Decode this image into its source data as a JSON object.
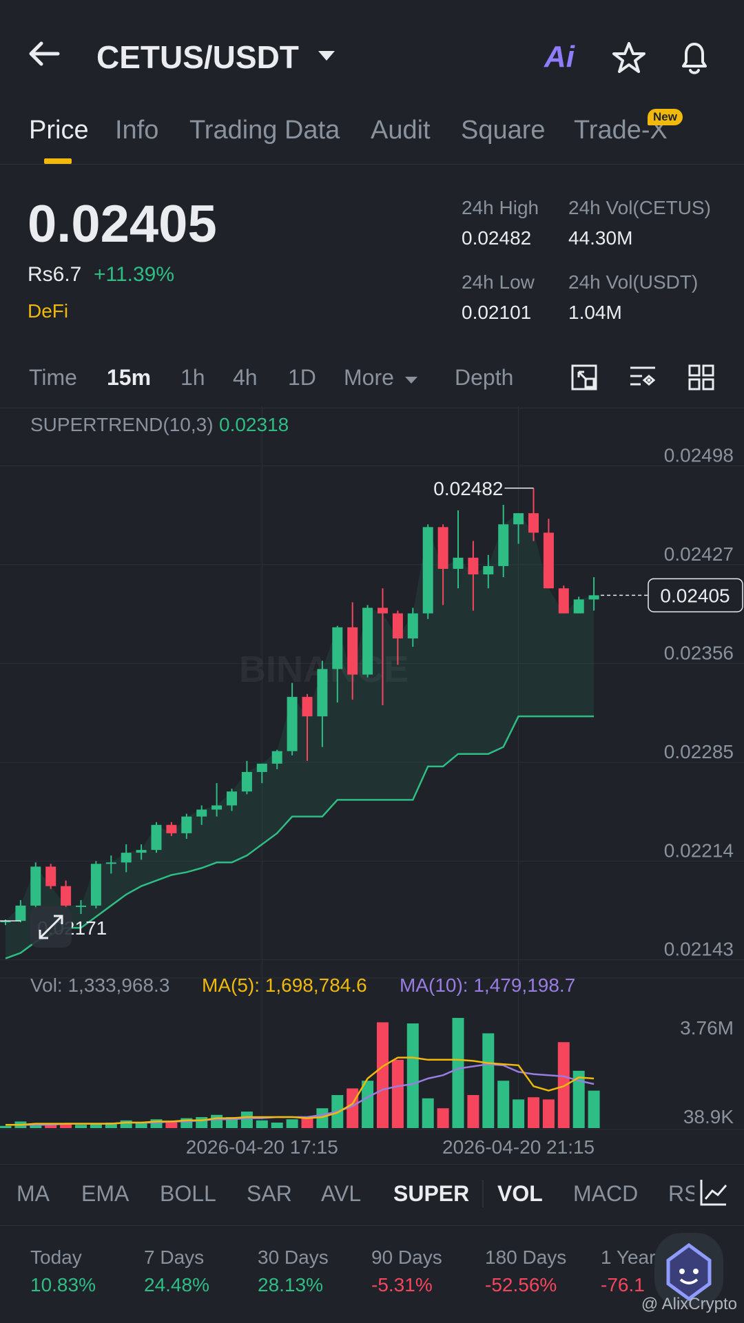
{
  "header": {
    "pair": "CETUS/USDT",
    "ai_label": "Ai"
  },
  "tabs": [
    {
      "label": "Price",
      "active": true
    },
    {
      "label": "Info"
    },
    {
      "label": "Trading Data"
    },
    {
      "label": "Audit"
    },
    {
      "label": "Square"
    },
    {
      "label": "Trade-X",
      "badge": "New"
    }
  ],
  "price": {
    "last": "0.02405",
    "fiat": "Rs6.7",
    "change": "+11.39%",
    "tag": "DeFi"
  },
  "stats": {
    "high_label": "24h High",
    "high": "0.02482",
    "vol_base_label": "24h Vol(CETUS)",
    "vol_base": "44.30M",
    "low_label": "24h Low",
    "low": "0.02101",
    "vol_quote_label": "24h Vol(USDT)",
    "vol_quote": "1.04M"
  },
  "intervals": [
    "Time",
    "15m",
    "1h",
    "4h",
    "1D",
    "More",
    "Depth"
  ],
  "active_interval": "15m",
  "chart_labels": {
    "supertrend_label": "SUPERTREND(10,3)",
    "supertrend_value": "0.02318",
    "watermark": "BINANCE",
    "current_price_tag": "0.02405",
    "high_marker": "0.02482",
    "low_marker": "0.02171",
    "vol_label": "Vol: 1,333,968.3",
    "ma5_label": "MA(5): 1,698,784.6",
    "ma10_label": "MA(10): 1,479,198.7",
    "vol_axis_top": "3.76M",
    "vol_axis_bottom": "38.9K"
  },
  "chart_data": {
    "type": "candlestick",
    "interval": "15m",
    "yticks": [
      "0.02498",
      "0.02427",
      "0.02356",
      "0.02285",
      "0.02214",
      "0.02143"
    ],
    "xticks": [
      "2026-04-20 17:15",
      "2026-04-20 21:15"
    ],
    "candles": [
      [
        0.0217,
        0.02172,
        0.02168,
        0.02171
      ],
      [
        0.02171,
        0.02186,
        0.0217,
        0.02182
      ],
      [
        0.02182,
        0.02213,
        0.0218,
        0.0221
      ],
      [
        0.0221,
        0.02212,
        0.02194,
        0.02196
      ],
      [
        0.02196,
        0.022,
        0.0218,
        0.02182
      ],
      [
        0.02182,
        0.02186,
        0.02176,
        0.02182
      ],
      [
        0.02182,
        0.02214,
        0.0218,
        0.02212
      ],
      [
        0.02212,
        0.02218,
        0.02205,
        0.02213
      ],
      [
        0.02213,
        0.02226,
        0.02206,
        0.0222
      ],
      [
        0.0222,
        0.02226,
        0.02215,
        0.02222
      ],
      [
        0.02222,
        0.02242,
        0.0222,
        0.0224
      ],
      [
        0.0224,
        0.02242,
        0.02232,
        0.02234
      ],
      [
        0.02234,
        0.02248,
        0.0223,
        0.02246
      ],
      [
        0.02246,
        0.02254,
        0.0224,
        0.02251
      ],
      [
        0.02251,
        0.0227,
        0.02246,
        0.02254
      ],
      [
        0.02254,
        0.02266,
        0.0225,
        0.02264
      ],
      [
        0.02264,
        0.02286,
        0.02262,
        0.02278
      ],
      [
        0.02278,
        0.02284,
        0.0227,
        0.02284
      ],
      [
        0.02284,
        0.02294,
        0.0228,
        0.02293
      ],
      [
        0.02293,
        0.02342,
        0.0229,
        0.02332
      ],
      [
        0.02332,
        0.02334,
        0.02286,
        0.02318
      ],
      [
        0.02318,
        0.02358,
        0.02296,
        0.02352
      ],
      [
        0.02352,
        0.02383,
        0.02328,
        0.02382
      ],
      [
        0.02382,
        0.024,
        0.0233,
        0.02348
      ],
      [
        0.02348,
        0.02398,
        0.02346,
        0.02396
      ],
      [
        0.02396,
        0.0241,
        0.02326,
        0.02392
      ],
      [
        0.02392,
        0.02394,
        0.02355,
        0.02374
      ],
      [
        0.02374,
        0.02396,
        0.02368,
        0.02392
      ],
      [
        0.02392,
        0.02456,
        0.02388,
        0.02454
      ],
      [
        0.02454,
        0.02456,
        0.02398,
        0.02424
      ],
      [
        0.02424,
        0.02466,
        0.0241,
        0.02432
      ],
      [
        0.02432,
        0.02444,
        0.02394,
        0.0242
      ],
      [
        0.0242,
        0.02434,
        0.0241,
        0.02426
      ],
      [
        0.02426,
        0.0247,
        0.02418,
        0.02456
      ],
      [
        0.02456,
        0.02464,
        0.02442,
        0.02464
      ],
      [
        0.02464,
        0.02482,
        0.02444,
        0.0245
      ],
      [
        0.0245,
        0.0246,
        0.0241,
        0.0241
      ],
      [
        0.0241,
        0.02412,
        0.02392,
        0.02392
      ],
      [
        0.02392,
        0.02404,
        0.02392,
        0.02402
      ],
      [
        0.02402,
        0.02418,
        0.02394,
        0.02405
      ]
    ],
    "supertrend": [
      0.02144,
      0.02148,
      0.02156,
      0.02161,
      0.02166,
      0.02166,
      0.02174,
      0.02182,
      0.0219,
      0.02196,
      0.022,
      0.02204,
      0.02206,
      0.02209,
      0.02213,
      0.02213,
      0.02218,
      0.02226,
      0.02234,
      0.02246,
      0.02246,
      0.02246,
      0.02258,
      0.02258,
      0.02258,
      0.02258,
      0.02258,
      0.02258,
      0.02282,
      0.02282,
      0.02291,
      0.02291,
      0.02291,
      0.02296,
      0.02318,
      0.02318,
      0.02318,
      0.02318,
      0.02318,
      0.02318
    ],
    "volume_relative": [
      0.02,
      0.06,
      0.04,
      0.04,
      0.04,
      0.03,
      0.04,
      0.05,
      0.07,
      0.05,
      0.08,
      0.06,
      0.09,
      0.1,
      0.12,
      0.1,
      0.15,
      0.07,
      0.05,
      0.08,
      0.09,
      0.18,
      0.3,
      0.36,
      0.43,
      0.96,
      0.62,
      0.95,
      0.27,
      0.18,
      1.0,
      0.3,
      0.86,
      0.43,
      0.26,
      0.28,
      0.26,
      0.78,
      0.52,
      0.34
    ],
    "ma5_relative": [
      0.03,
      0.03,
      0.04,
      0.04,
      0.04,
      0.04,
      0.04,
      0.04,
      0.05,
      0.05,
      0.06,
      0.06,
      0.07,
      0.07,
      0.09,
      0.09,
      0.1,
      0.1,
      0.1,
      0.1,
      0.09,
      0.1,
      0.14,
      0.22,
      0.45,
      0.56,
      0.64,
      0.64,
      0.62,
      0.62,
      0.62,
      0.61,
      0.59,
      0.58,
      0.57,
      0.38,
      0.34,
      0.38,
      0.46,
      0.45
    ],
    "ma10_relative": [
      0.03,
      0.03,
      0.03,
      0.03,
      0.04,
      0.04,
      0.04,
      0.04,
      0.05,
      0.05,
      0.05,
      0.06,
      0.06,
      0.07,
      0.08,
      0.08,
      0.09,
      0.09,
      0.1,
      0.1,
      0.1,
      0.12,
      0.15,
      0.2,
      0.28,
      0.35,
      0.38,
      0.4,
      0.45,
      0.48,
      0.54,
      0.56,
      0.58,
      0.57,
      0.51,
      0.49,
      0.48,
      0.47,
      0.43,
      0.4
    ]
  },
  "indicators": [
    "MA",
    "EMA",
    "BOLL",
    "SAR",
    "AVL",
    "SUPER",
    "VOL",
    "MACD",
    "RSI"
  ],
  "active_indicators": [
    "SUPER",
    "VOL"
  ],
  "performance": [
    {
      "label": "Today",
      "value": "10.83%",
      "dir": "up"
    },
    {
      "label": "7 Days",
      "value": "24.48%",
      "dir": "up"
    },
    {
      "label": "30 Days",
      "value": "28.13%",
      "dir": "up"
    },
    {
      "label": "90 Days",
      "value": "-5.31%",
      "dir": "down"
    },
    {
      "label": "180 Days",
      "value": "-52.56%",
      "dir": "down"
    },
    {
      "label": "1 Year",
      "value": "-76.1",
      "dir": "down"
    }
  ],
  "credit": "@ AlixCrypto",
  "colors": {
    "up": "#2ebd85",
    "down": "#f6465d",
    "accent": "#f0b90b",
    "ma5": "#f0b90b",
    "ma10": "#9a7de3"
  }
}
